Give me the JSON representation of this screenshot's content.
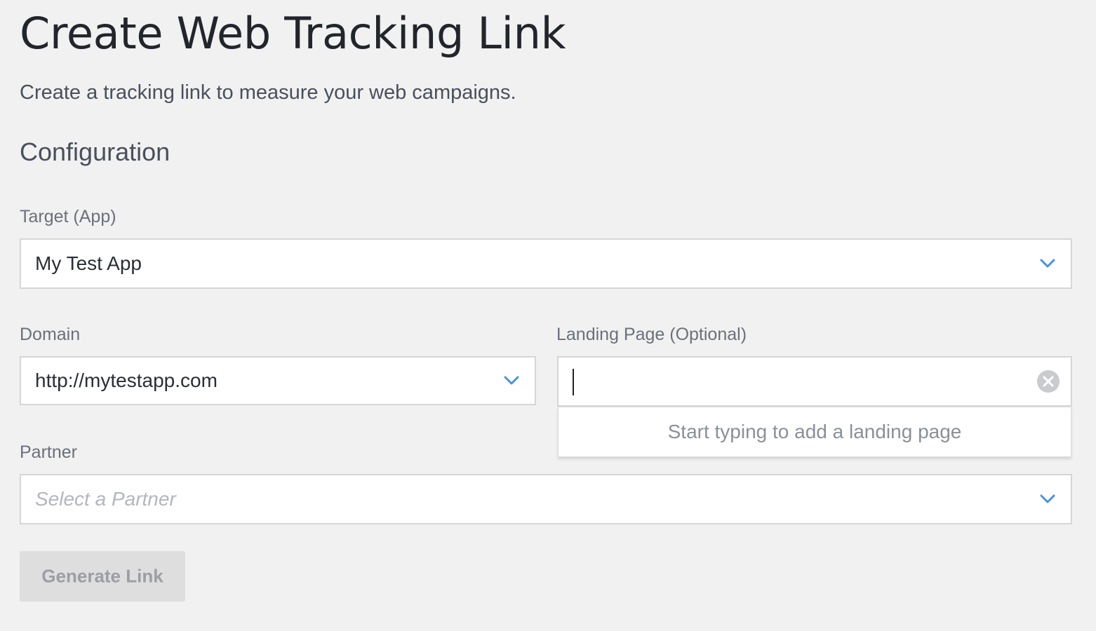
{
  "page": {
    "title": "Create Web Tracking Link",
    "subtitle": "Create a tracking link to measure your web campaigns.",
    "section_title": "Configuration"
  },
  "colors": {
    "accent": "#4a90e2",
    "background": "#f1f1f1",
    "button_disabled": "#dedede"
  },
  "form": {
    "target": {
      "label": "Target (App)",
      "value": "My Test App",
      "icon": "chevron-down-icon"
    },
    "domain": {
      "label": "Domain",
      "value": "http://mytestapp.com",
      "icon": "chevron-down-icon"
    },
    "landing_page": {
      "label": "Landing Page (Optional)",
      "value": "",
      "clear_icon": "clear-circle-icon",
      "dropdown_hint": "Start typing to add a landing page"
    },
    "partner": {
      "label": "Partner",
      "placeholder": "Select a Partner",
      "icon": "chevron-down-icon"
    },
    "generate_button": {
      "label": "Generate Link",
      "disabled": true
    }
  }
}
